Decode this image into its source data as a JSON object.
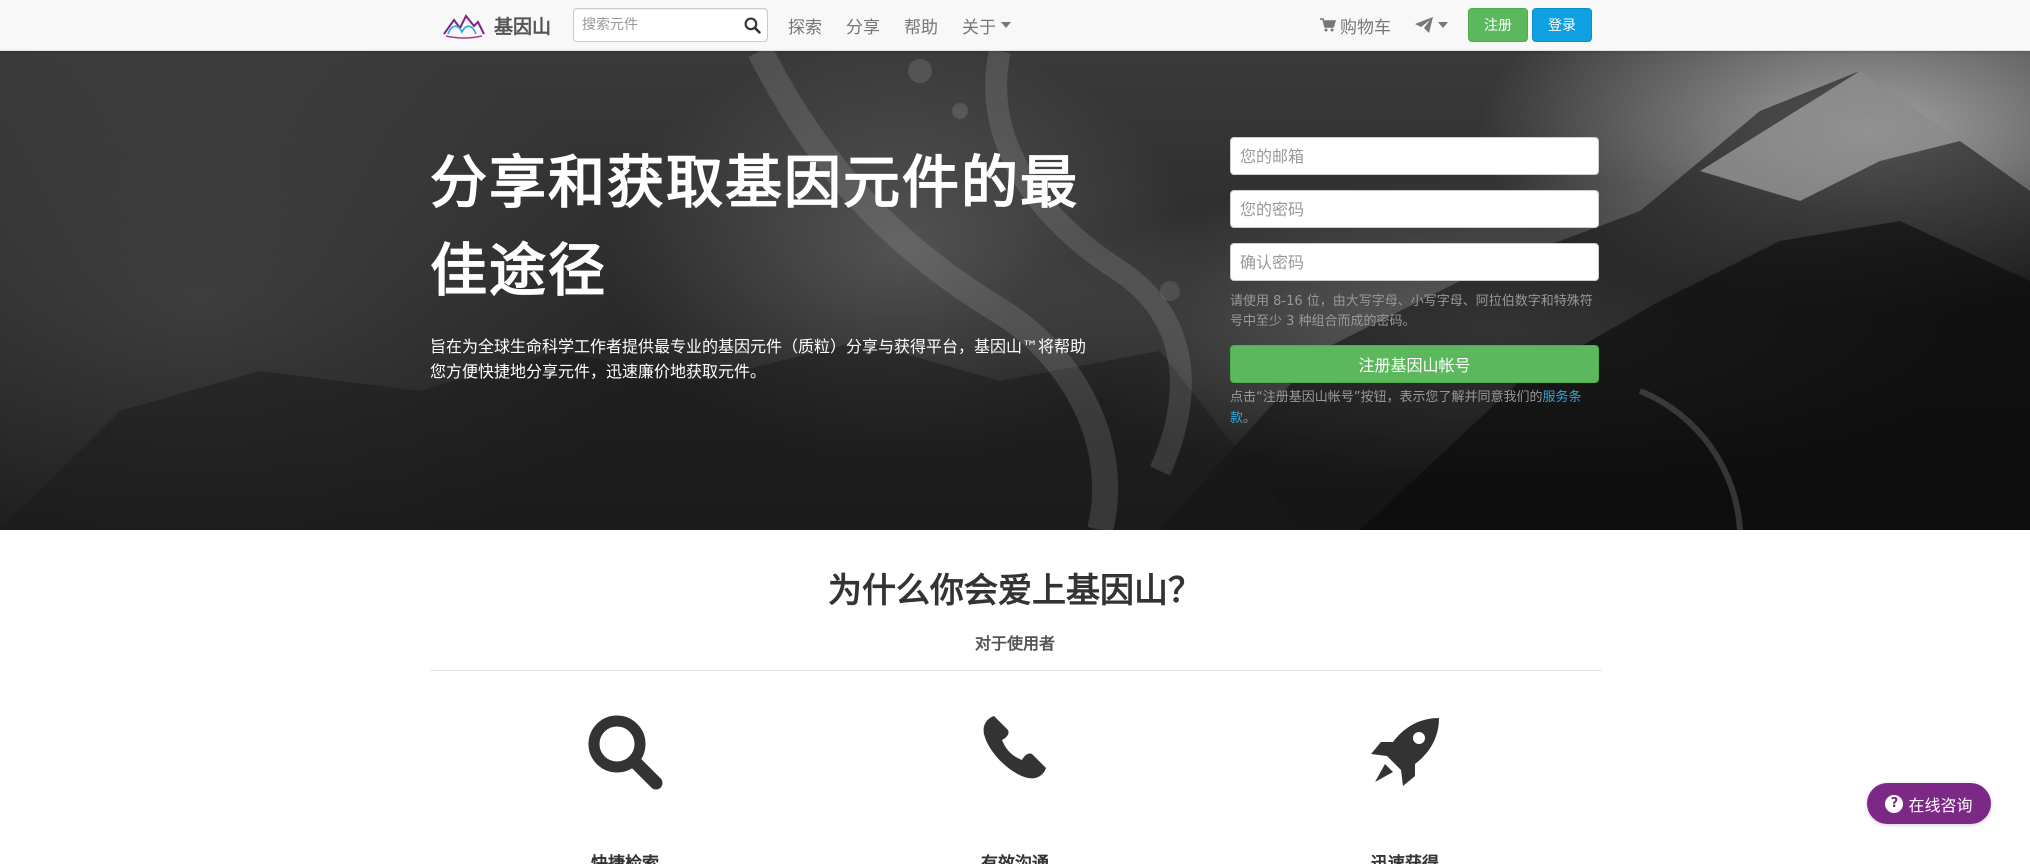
{
  "navbar": {
    "brand_name": "基因山",
    "search_placeholder": "搜索元件",
    "links": [
      {
        "label": "探索"
      },
      {
        "label": "分享"
      },
      {
        "label": "帮助"
      },
      {
        "label": "关于"
      }
    ],
    "cart_label": "购物车",
    "register_label": "注册",
    "login_label": "登录"
  },
  "hero": {
    "title": "分享和获取基因元件的最佳途径",
    "subtitle": "旨在为全球生命科学工作者提供最专业的基因元件（质粒）分享与获得平台，基因山™将帮助您方便快捷地分享元件，迅速廉价地获取元件。"
  },
  "signup_form": {
    "email_placeholder": "您的邮箱",
    "password_placeholder": "您的密码",
    "confirm_placeholder": "确认密码",
    "password_hint": "请使用 8-16 位，由大写字母、小写字母、阿拉伯数字和特殊符号中至少 3 种组合而成的密码。",
    "submit_label": "注册基因山帐号",
    "terms_text": "点击“注册基因山帐号”按钮，表示您了解并同意我们的",
    "terms_link": "服务条款",
    "terms_end": "。"
  },
  "why": {
    "title": "为什么你会爱上基因山？",
    "subtitle": "对于使用者",
    "features": [
      {
        "icon": "search-icon",
        "label": "快捷检索"
      },
      {
        "icon": "phone-icon",
        "label": "有效沟通"
      },
      {
        "icon": "rocket-icon",
        "label": "迅速获得"
      }
    ]
  },
  "consult": {
    "label": "在线咨询",
    "icon": "?"
  },
  "colors": {
    "green": "#5cb85c",
    "blue": "#0ea0e0",
    "purple": "#7b2886",
    "link": "#2aa8e0"
  }
}
